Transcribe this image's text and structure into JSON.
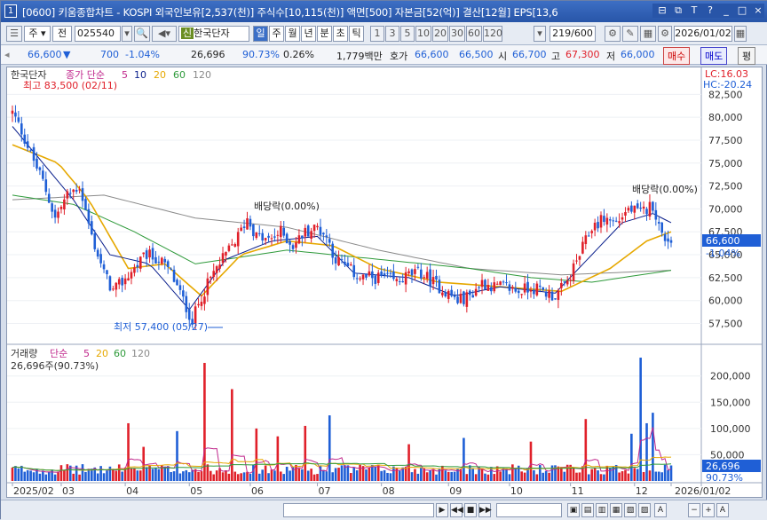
{
  "titlebar": {
    "number": "1",
    "title": "[0600] 키움종합차트 - KOSPI 외국인보유[2,537(천)] 주식수[10,115(천)] 액면[500] 자본금[52(억)] 결산[12월] EPS[13,6",
    "buttons": [
      "⊟",
      "⧉",
      "T",
      "?",
      "_",
      "□",
      "×"
    ]
  },
  "toolbar": {
    "market": "주",
    "mode": "전",
    "code": "025540",
    "stock_name": "한국단자",
    "period_tabs": [
      "일",
      "주",
      "월",
      "년",
      "분",
      "초",
      "틱"
    ],
    "active_period": "일",
    "minute_options": [
      "1",
      "3",
      "5",
      "10",
      "20",
      "30",
      "60",
      "120"
    ],
    "count": "219/600",
    "date": "2026/01/02"
  },
  "quote": {
    "price": "66,600",
    "change_arrow": "▼",
    "change": "700",
    "change_pct": "-1.04%",
    "volume": "26,696",
    "volume_ratio": "90.73%",
    "turnover": "0.26%",
    "amount": "1,779백만",
    "ask_label": "호가",
    "ask": "66,600",
    "bid": "66,500",
    "open_label": "시",
    "open": "66,700",
    "high_label": "고",
    "high": "67,300",
    "low_label": "저",
    "low": "66,000",
    "sell_btn": "매수",
    "buy_btn": "매도",
    "eval_btn": "평"
  },
  "price_panel": {
    "legend_name": "한국단자",
    "legend_type": "종가 단순",
    "ma_periods": [
      "5",
      "10",
      "20",
      "60",
      "120"
    ],
    "lc": "LC:16.03",
    "hc": "HC:-20.24",
    "high_note": "최고 83,500 (02/11)",
    "low_note": "최저 57,400 (05/27)",
    "div_note1": "배당락(0.00%)",
    "div_note2": "배당락(0.00%)",
    "current_price_label": "66,600",
    "current_change_label": "-1.04%",
    "y_ticks": [
      "82,500",
      "80,000",
      "77,500",
      "75,000",
      "72,500",
      "70,000",
      "67,500",
      "65,000",
      "62,500",
      "60,000",
      "57,500"
    ]
  },
  "volume_panel": {
    "legend_name": "거래량",
    "legend_type": "단순",
    "ma_periods": [
      "5",
      "20",
      "60",
      "120"
    ],
    "info": "26,696주(90.73%)",
    "y_ticks": [
      "200,000",
      "150,000",
      "100,000",
      "50,000"
    ],
    "current_volume_label": "26,696",
    "current_ratio_label": "90.73%"
  },
  "x_axis": {
    "labels": [
      "2025/02",
      "03",
      "04",
      "05",
      "06",
      "07",
      "08",
      "09",
      "10",
      "11",
      "12",
      "2026/01/02"
    ]
  },
  "colors": {
    "up": "#e0202a",
    "down": "#1f5fd6",
    "ma5": "#c0288c",
    "ma10": "#0a1f8c",
    "ma20": "#e6a800",
    "ma60": "#2e9a3a",
    "ma120": "#8a8a8a"
  },
  "chart_data": {
    "type": "candlestick",
    "price_range": [
      56000,
      83500
    ],
    "volume_range": [
      0,
      230000
    ],
    "price_anchors": [
      [
        0,
        80500
      ],
      [
        3,
        78500
      ],
      [
        6,
        76000
      ],
      [
        10,
        73000
      ],
      [
        14,
        69000
      ],
      [
        18,
        71500
      ],
      [
        22,
        72500
      ],
      [
        26,
        67000
      ],
      [
        30,
        63000
      ],
      [
        33,
        61000
      ],
      [
        36,
        62000
      ],
      [
        40,
        63500
      ],
      [
        44,
        65000
      ],
      [
        48,
        64500
      ],
      [
        52,
        63000
      ],
      [
        56,
        60000
      ],
      [
        59,
        57800
      ],
      [
        62,
        60500
      ],
      [
        66,
        63000
      ],
      [
        70,
        65000
      ],
      [
        74,
        67000
      ],
      [
        77,
        69000
      ],
      [
        80,
        67000
      ],
      [
        84,
        66500
      ],
      [
        88,
        67500
      ],
      [
        92,
        66000
      ],
      [
        96,
        67500
      ],
      [
        100,
        68000
      ],
      [
        103,
        67000
      ],
      [
        106,
        64500
      ],
      [
        110,
        63500
      ],
      [
        114,
        62500
      ],
      [
        118,
        62500
      ],
      [
        122,
        62500
      ],
      [
        126,
        62000
      ],
      [
        130,
        62800
      ],
      [
        134,
        63000
      ],
      [
        138,
        62000
      ],
      [
        142,
        61000
      ],
      [
        146,
        60000
      ],
      [
        150,
        60500
      ],
      [
        154,
        62000
      ],
      [
        158,
        61500
      ],
      [
        162,
        61500
      ],
      [
        166,
        61000
      ],
      [
        170,
        61500
      ],
      [
        174,
        61000
      ],
      [
        178,
        60500
      ],
      [
        182,
        62000
      ],
      [
        186,
        65000
      ],
      [
        190,
        68000
      ],
      [
        194,
        69000
      ],
      [
        198,
        68500
      ],
      [
        202,
        70000
      ],
      [
        206,
        69500
      ],
      [
        210,
        70500
      ],
      [
        213,
        67000
      ],
      [
        216,
        66600
      ]
    ],
    "volume_spikes": [
      [
        38,
        110000
      ],
      [
        43,
        65000
      ],
      [
        54,
        95000
      ],
      [
        63,
        225000
      ],
      [
        72,
        175000
      ],
      [
        80,
        100000
      ],
      [
        87,
        85000
      ],
      [
        96,
        105000
      ],
      [
        104,
        125000
      ],
      [
        130,
        70000
      ],
      [
        148,
        82000
      ],
      [
        170,
        75000
      ],
      [
        188,
        118000
      ],
      [
        203,
        90000
      ],
      [
        206,
        235000
      ],
      [
        208,
        110000
      ],
      [
        210,
        130000
      ]
    ],
    "ma_lines": [
      {
        "name": "120",
        "anchors": [
          [
            0,
            71000
          ],
          [
            30,
            71500
          ],
          [
            60,
            69000
          ],
          [
            90,
            68000
          ],
          [
            120,
            65500
          ],
          [
            150,
            63500
          ],
          [
            180,
            62800
          ],
          [
            216,
            63300
          ]
        ]
      },
      {
        "name": "60",
        "anchors": [
          [
            0,
            71500
          ],
          [
            20,
            70500
          ],
          [
            40,
            67500
          ],
          [
            60,
            64000
          ],
          [
            90,
            65500
          ],
          [
            120,
            64500
          ],
          [
            150,
            63500
          ],
          [
            170,
            62500
          ],
          [
            190,
            62000
          ],
          [
            216,
            63300
          ]
        ]
      },
      {
        "name": "20",
        "anchors": [
          [
            0,
            77000
          ],
          [
            15,
            75000
          ],
          [
            25,
            71000
          ],
          [
            38,
            63500
          ],
          [
            50,
            64000
          ],
          [
            62,
            60500
          ],
          [
            75,
            65000
          ],
          [
            90,
            66500
          ],
          [
            105,
            66000
          ],
          [
            120,
            63500
          ],
          [
            140,
            62000
          ],
          [
            160,
            61500
          ],
          [
            180,
            61000
          ],
          [
            196,
            63500
          ],
          [
            208,
            66500
          ],
          [
            216,
            67500
          ]
        ]
      },
      {
        "name": "10",
        "anchors": [
          [
            0,
            79000
          ],
          [
            10,
            75000
          ],
          [
            20,
            71000
          ],
          [
            32,
            65000
          ],
          [
            45,
            64000
          ],
          [
            58,
            59000
          ],
          [
            70,
            64500
          ],
          [
            85,
            66500
          ],
          [
            100,
            67000
          ],
          [
            112,
            63000
          ],
          [
            130,
            62500
          ],
          [
            145,
            60500
          ],
          [
            160,
            61500
          ],
          [
            178,
            60800
          ],
          [
            190,
            65000
          ],
          [
            200,
            68500
          ],
          [
            210,
            69500
          ],
          [
            216,
            68500
          ]
        ]
      }
    ]
  }
}
